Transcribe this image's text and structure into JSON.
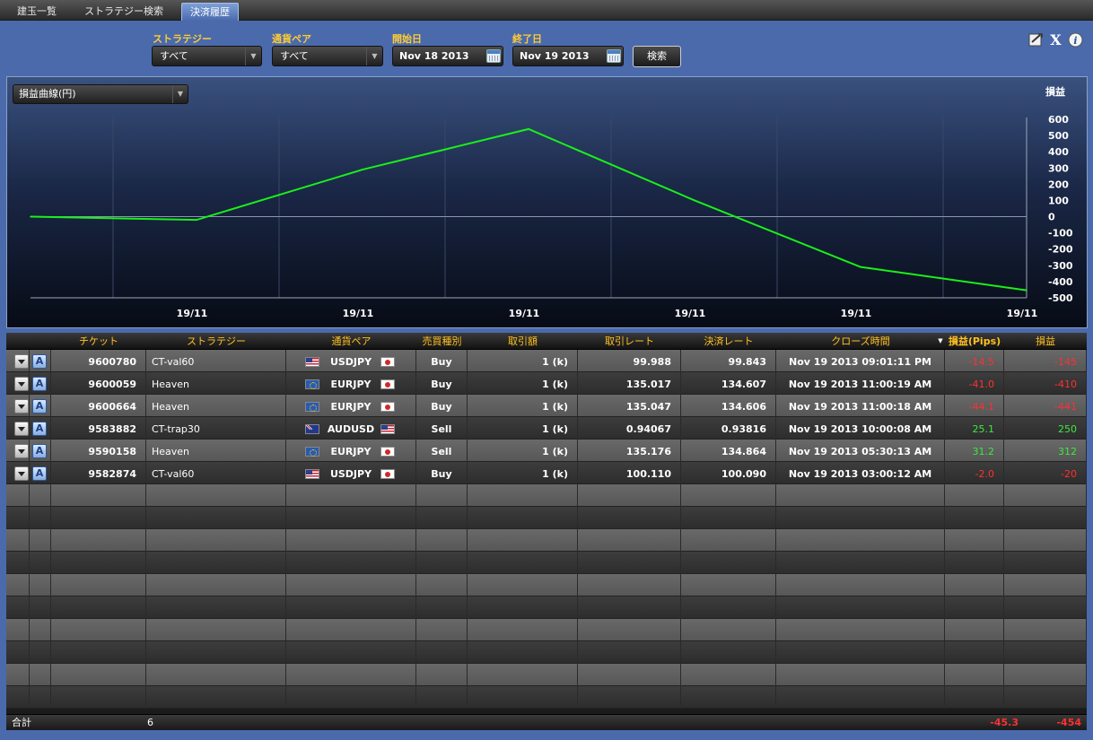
{
  "tabs": [
    {
      "label": "建玉一覧",
      "active": false
    },
    {
      "label": "ストラテジー検索",
      "active": false
    },
    {
      "label": "決済履歴",
      "active": true
    }
  ],
  "filters": {
    "strategy_label": "ストラテジー",
    "strategy_value": "すべて",
    "pair_label": "通貨ペア",
    "pair_value": "すべて",
    "start_label": "開始日",
    "start_value": "Nov 18 2013",
    "end_label": "終了日",
    "end_value": "Nov 19 2013",
    "search_label": "検索"
  },
  "toolbar_icons": [
    "export-icon",
    "excel-icon",
    "info-icon"
  ],
  "chart_selector": "損益曲線(円)",
  "chart_data": {
    "type": "line",
    "title": "",
    "ylabel": "損益",
    "xlabel": "",
    "ylim": [
      -500,
      600
    ],
    "yticks": [
      600,
      500,
      400,
      300,
      200,
      100,
      0,
      -100,
      -200,
      -300,
      -400,
      -500
    ],
    "xtick_labels": [
      "19/11",
      "19/11",
      "19/11",
      "19/11",
      "19/11",
      "19/11"
    ],
    "series": [
      {
        "color": "#19f019",
        "values": [
          0,
          -20,
          290,
          540,
          100,
          -310,
          -454
        ]
      }
    ]
  },
  "table": {
    "headers": {
      "ticket": "チケット",
      "strategy": "ストラテジー",
      "pair": "通貨ペア",
      "side": "売買種別",
      "amount": "取引額",
      "open_rate": "取引レート",
      "close_rate": "決済レート",
      "close_time": "クローズ時間",
      "pips": "損益(Pips)",
      "pl": "損益"
    },
    "rows": [
      {
        "ticket": "9600780",
        "strategy": "CT-val60",
        "flag1": "us",
        "pair": "USDJPY",
        "flag2": "jp",
        "side": "Buy",
        "amount": "1 (k)",
        "open_rate": "99.988",
        "close_rate": "99.843",
        "close_time": "Nov 19 2013 09:01:11 PM",
        "pips": "-14.5",
        "pl": "-145"
      },
      {
        "ticket": "9600059",
        "strategy": "Heaven",
        "flag1": "eu",
        "pair": "EURJPY",
        "flag2": "jp",
        "side": "Buy",
        "amount": "1 (k)",
        "open_rate": "135.017",
        "close_rate": "134.607",
        "close_time": "Nov 19 2013 11:00:19 AM",
        "pips": "-41.0",
        "pl": "-410"
      },
      {
        "ticket": "9600664",
        "strategy": "Heaven",
        "flag1": "eu",
        "pair": "EURJPY",
        "flag2": "jp",
        "side": "Buy",
        "amount": "1 (k)",
        "open_rate": "135.047",
        "close_rate": "134.606",
        "close_time": "Nov 19 2013 11:00:18 AM",
        "pips": "-44.1",
        "pl": "-441"
      },
      {
        "ticket": "9583882",
        "strategy": "CT-trap30",
        "flag1": "au",
        "pair": "AUDUSD",
        "flag2": "us",
        "side": "Sell",
        "amount": "1 (k)",
        "open_rate": "0.94067",
        "close_rate": "0.93816",
        "close_time": "Nov 19 2013 10:00:08 AM",
        "pips": "25.1",
        "pl": "250"
      },
      {
        "ticket": "9590158",
        "strategy": "Heaven",
        "flag1": "eu",
        "pair": "EURJPY",
        "flag2": "jp",
        "side": "Sell",
        "amount": "1 (k)",
        "open_rate": "135.176",
        "close_rate": "134.864",
        "close_time": "Nov 19 2013 05:30:13 AM",
        "pips": "31.2",
        "pl": "312"
      },
      {
        "ticket": "9582874",
        "strategy": "CT-val60",
        "flag1": "us",
        "pair": "USDJPY",
        "flag2": "jp",
        "side": "Buy",
        "amount": "1 (k)",
        "open_rate": "100.110",
        "close_rate": "100.090",
        "close_time": "Nov 19 2013 03:00:12 AM",
        "pips": "-2.0",
        "pl": "-20"
      }
    ]
  },
  "footer": {
    "label": "合計",
    "count": "6",
    "pips": "-45.3",
    "pl": "-454"
  },
  "colors": {
    "accent": "#4a6aac",
    "header_text": "#ffc020",
    "negative": "#ff3030",
    "positive": "#3ee93e",
    "line": "#19f019"
  }
}
